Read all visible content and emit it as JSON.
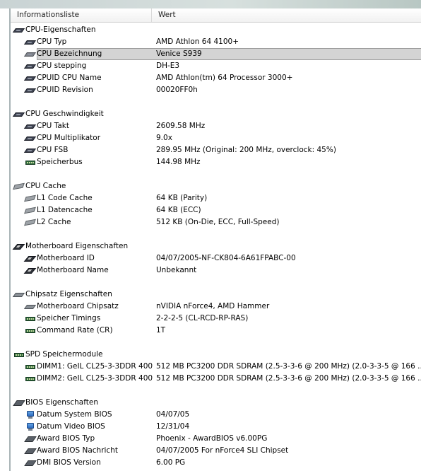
{
  "header": {
    "col1": "Informationsliste",
    "col2": "Wert"
  },
  "rows": [
    {
      "type": "group",
      "icon": "cpu-icon",
      "label": "CPU-Eigenschaften",
      "value": ""
    },
    {
      "type": "item",
      "icon": "cpu-icon",
      "label": "CPU Typ",
      "value": "AMD Athlon 64 4100+"
    },
    {
      "type": "item",
      "icon": "cpu-icon",
      "label": "CPU Bezeichnung",
      "value": "Venice S939",
      "selected": true
    },
    {
      "type": "item",
      "icon": "cpu-icon",
      "label": "CPU stepping",
      "value": "DH-E3"
    },
    {
      "type": "item",
      "icon": "cpu-icon",
      "label": "CPUID CPU Name",
      "value": "AMD Athlon(tm) 64 Processor 3000+"
    },
    {
      "type": "item",
      "icon": "cpu-icon",
      "label": "CPUID Revision",
      "value": "00020FF0h"
    },
    {
      "type": "blank"
    },
    {
      "type": "group",
      "icon": "cpu-icon",
      "label": "CPU Geschwindigkeit",
      "value": ""
    },
    {
      "type": "item",
      "icon": "cpu-icon",
      "label": "CPU Takt",
      "value": "2609.58 MHz"
    },
    {
      "type": "item",
      "icon": "cpu-icon",
      "label": "CPU Multiplikator",
      "value": "9.0x"
    },
    {
      "type": "item",
      "icon": "cpu-icon",
      "label": "CPU FSB",
      "value": "289.95 MHz  (Original: 200 MHz, overclock: 45%)"
    },
    {
      "type": "item",
      "icon": "ram-icon",
      "label": "Speicherbus",
      "value": "144.98 MHz"
    },
    {
      "type": "blank"
    },
    {
      "type": "group",
      "icon": "cache-icon",
      "label": "CPU Cache",
      "value": ""
    },
    {
      "type": "item",
      "icon": "cache-icon",
      "label": "L1 Code Cache",
      "value": "64 KB  (Parity)"
    },
    {
      "type": "item",
      "icon": "cache-icon",
      "label": "L1 Datencache",
      "value": "64 KB  (ECC)"
    },
    {
      "type": "item",
      "icon": "cache-icon",
      "label": "L2 Cache",
      "value": "512 KB  (On-Die, ECC, Full-Speed)"
    },
    {
      "type": "blank"
    },
    {
      "type": "group",
      "icon": "motherboard-icon",
      "label": "Motherboard Eigenschaften",
      "value": ""
    },
    {
      "type": "item",
      "icon": "motherboard-icon",
      "label": "Motherboard ID",
      "value": "04/07/2005-NF-CK804-6A61FPABC-00"
    },
    {
      "type": "item",
      "icon": "motherboard-icon",
      "label": "Motherboard Name",
      "value": "Unbekannt"
    },
    {
      "type": "blank"
    },
    {
      "type": "group",
      "icon": "chipset-icon",
      "label": "Chipsatz Eigenschaften",
      "value": ""
    },
    {
      "type": "item",
      "icon": "chipset-icon",
      "label": "Motherboard Chipsatz",
      "value": "nVIDIA nForce4, AMD Hammer"
    },
    {
      "type": "item",
      "icon": "ram-icon",
      "label": "Speicher Timings",
      "value": "2-2-2-5  (CL-RCD-RP-RAS)"
    },
    {
      "type": "item",
      "icon": "ram-icon",
      "label": "Command Rate (CR)",
      "value": "1T"
    },
    {
      "type": "blank"
    },
    {
      "type": "group",
      "icon": "ram-icon",
      "label": "SPD Speichermodule",
      "value": ""
    },
    {
      "type": "item",
      "icon": "ram-icon",
      "label": "DIMM1: GeIL CL25-3-3DDR 400",
      "value": "512 MB PC3200 DDR SDRAM  (2.5-3-3-6 @ 200 MHz)  (2.0-3-3-5 @ 166 ..."
    },
    {
      "type": "item",
      "icon": "ram-icon",
      "label": "DIMM2: GeIL CL25-3-3DDR 400",
      "value": "512 MB PC3200 DDR SDRAM  (2.5-3-3-6 @ 200 MHz)  (2.0-3-3-5 @ 166 ..."
    },
    {
      "type": "blank"
    },
    {
      "type": "group",
      "icon": "bios-chip-icon",
      "label": "BIOS Eigenschaften",
      "value": ""
    },
    {
      "type": "item",
      "icon": "bios-icon",
      "label": "Datum System BIOS",
      "value": "04/07/05"
    },
    {
      "type": "item",
      "icon": "bios-icon",
      "label": "Datum Video BIOS",
      "value": "12/31/04"
    },
    {
      "type": "item",
      "icon": "bios-chip-icon",
      "label": "Award BIOS Typ",
      "value": "Phoenix - AwardBIOS v6.00PG"
    },
    {
      "type": "item",
      "icon": "bios-chip-icon",
      "label": "Award BIOS Nachricht",
      "value": "04/07/2005 For nForce4 SLI Chipset"
    },
    {
      "type": "item",
      "icon": "bios-chip-icon",
      "label": "DMI BIOS Version",
      "value": "6.00 PG"
    }
  ]
}
